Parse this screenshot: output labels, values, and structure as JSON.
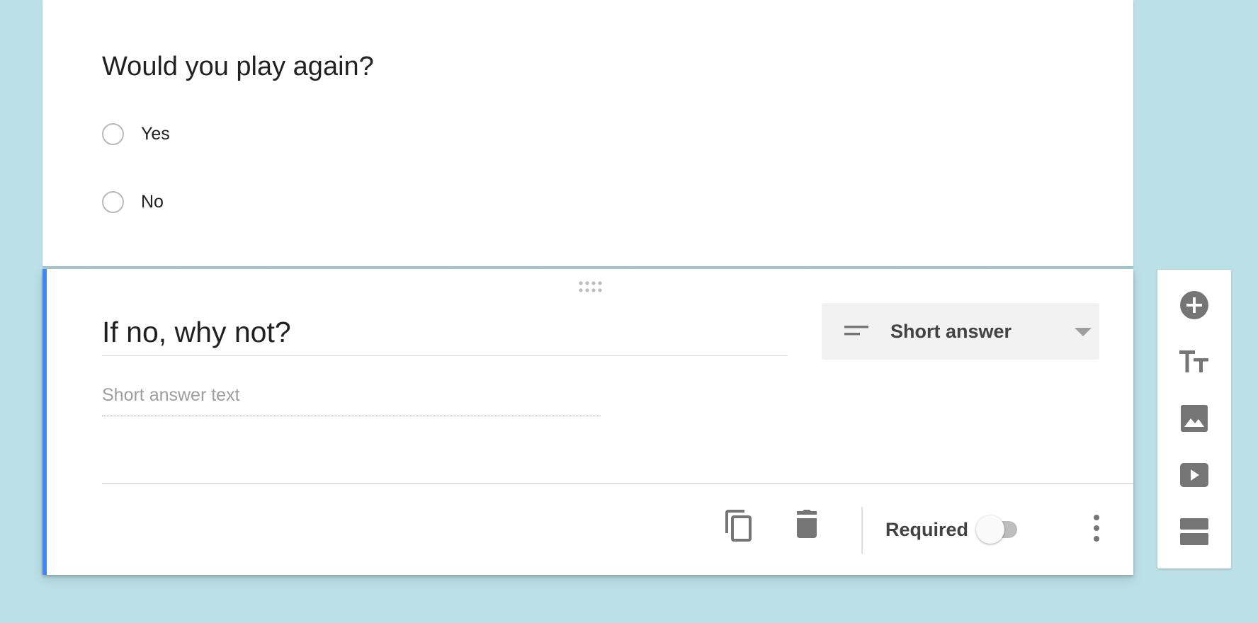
{
  "question1": {
    "title": "Would you play again?",
    "options": [
      {
        "label": "Yes"
      },
      {
        "label": "No"
      }
    ]
  },
  "question2": {
    "title": "If no, why not?",
    "answer_type": {
      "label": "Short answer",
      "icon": "short-text-lines-icon"
    },
    "placeholder": "Short answer text",
    "footer": {
      "required_label": "Required",
      "required_on": false,
      "icons": [
        "copy-icon",
        "trash-icon",
        "more-vert-icon"
      ]
    }
  },
  "side_toolbar": {
    "tools": [
      "add-question-icon",
      "add-title-icon",
      "add-image-icon",
      "add-video-icon",
      "add-section-icon"
    ]
  },
  "colors": {
    "background": "#bce0e8",
    "active_accent": "#4285f4",
    "icon": "#757575"
  }
}
